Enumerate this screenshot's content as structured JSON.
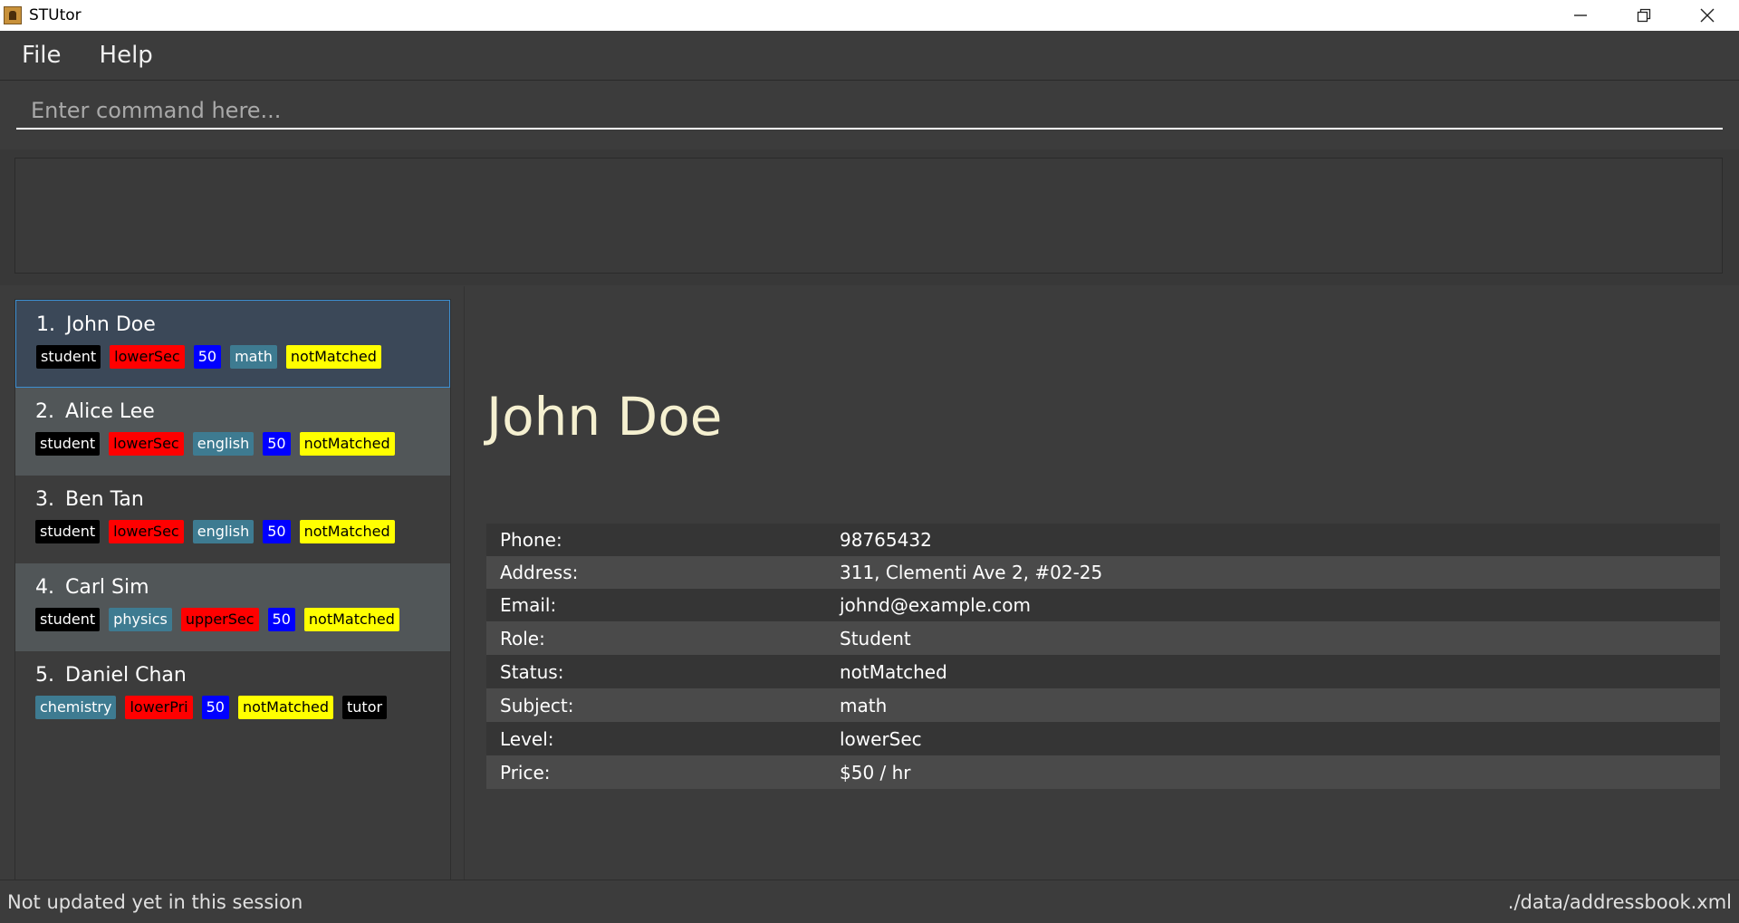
{
  "window": {
    "title": "STUtor",
    "controls": [
      "minimize-icon",
      "restore-icon",
      "close-icon"
    ]
  },
  "menu": {
    "items": [
      "File",
      "Help"
    ]
  },
  "command": {
    "placeholder": "Enter command here...",
    "value": ""
  },
  "result": {
    "text": ""
  },
  "people": [
    {
      "index": "1.",
      "name": "John Doe",
      "tags": [
        {
          "label": "student",
          "color": "black"
        },
        {
          "label": "lowerSec",
          "color": "red"
        },
        {
          "label": "50",
          "color": "blue"
        },
        {
          "label": "math",
          "color": "teal"
        },
        {
          "label": "notMatched",
          "color": "yellow"
        }
      ]
    },
    {
      "index": "2.",
      "name": "Alice Lee",
      "tags": [
        {
          "label": "student",
          "color": "black"
        },
        {
          "label": "lowerSec",
          "color": "red"
        },
        {
          "label": "english",
          "color": "teal"
        },
        {
          "label": "50",
          "color": "blue"
        },
        {
          "label": "notMatched",
          "color": "yellow"
        }
      ]
    },
    {
      "index": "3.",
      "name": "Ben Tan",
      "tags": [
        {
          "label": "student",
          "color": "black"
        },
        {
          "label": "lowerSec",
          "color": "red"
        },
        {
          "label": "english",
          "color": "teal"
        },
        {
          "label": "50",
          "color": "blue"
        },
        {
          "label": "notMatched",
          "color": "yellow"
        }
      ]
    },
    {
      "index": "4.",
      "name": "Carl Sim",
      "tags": [
        {
          "label": "student",
          "color": "black"
        },
        {
          "label": "physics",
          "color": "teal"
        },
        {
          "label": "upperSec",
          "color": "red"
        },
        {
          "label": "50",
          "color": "blue"
        },
        {
          "label": "notMatched",
          "color": "yellow"
        }
      ]
    },
    {
      "index": "5.",
      "name": "Daniel Chan",
      "tags": [
        {
          "label": "chemistry",
          "color": "teal"
        },
        {
          "label": "lowerPri",
          "color": "red"
        },
        {
          "label": "50",
          "color": "blue"
        },
        {
          "label": "notMatched",
          "color": "yellow"
        },
        {
          "label": "tutor",
          "color": "black"
        }
      ]
    }
  ],
  "selected_index": 0,
  "tag_colors": {
    "black": "#000000",
    "red": "#ff0000",
    "blue": "#0000ff",
    "teal": "#3e7b91",
    "yellow": "#ffff00"
  },
  "detail": {
    "name": "John Doe",
    "rows": [
      {
        "label": "Phone:",
        "value": "98765432"
      },
      {
        "label": "Address:",
        "value": "311, Clementi Ave 2, #02-25"
      },
      {
        "label": "Email:",
        "value": "johnd@example.com"
      },
      {
        "label": "Role:",
        "value": "Student"
      },
      {
        "label": "Status:",
        "value": "notMatched"
      },
      {
        "label": "Subject:",
        "value": "math"
      },
      {
        "label": "Level:",
        "value": "lowerSec"
      },
      {
        "label": "Price:",
        "value": "$50 / hr"
      }
    ]
  },
  "status": {
    "left": "Not updated yet in this session",
    "right": "./data/addressbook.xml"
  }
}
